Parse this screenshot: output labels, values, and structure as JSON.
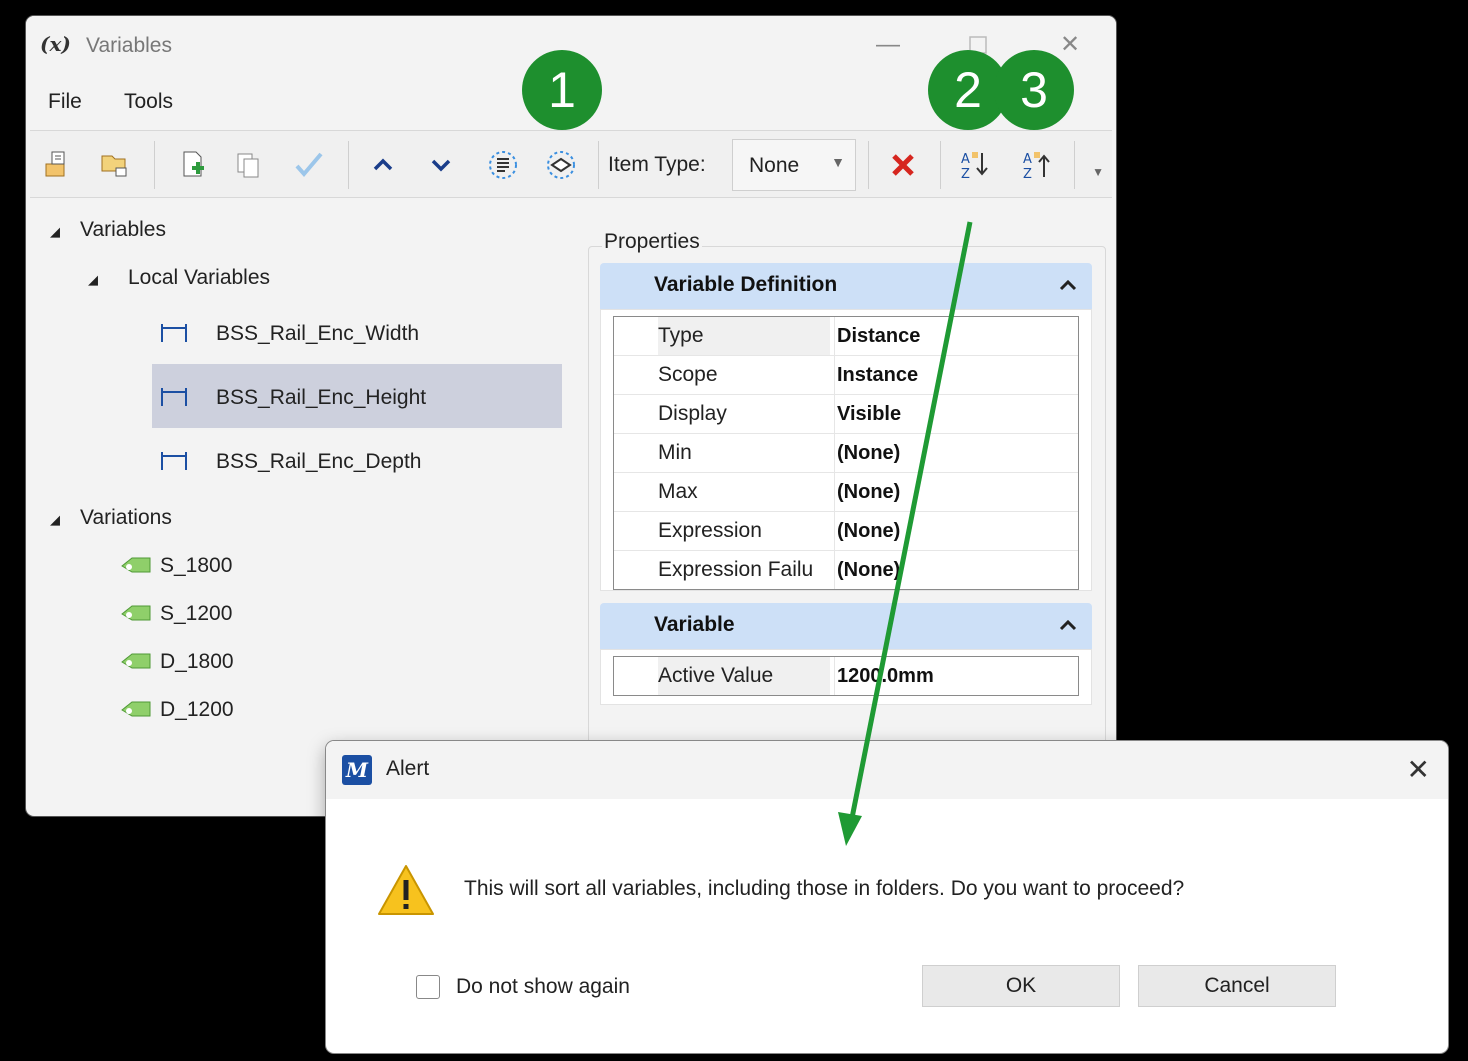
{
  "window": {
    "app_icon": "(x)",
    "title": "Variables",
    "minimize": "—",
    "close": "✕"
  },
  "menu": [
    "File",
    "Tools"
  ],
  "toolbar": {
    "item_type_label": "Item Type:",
    "item_type_value": "None",
    "icons": [
      "new-folder-icon",
      "new-variable-icon",
      "add-icon",
      "copy-icon",
      "check-icon",
      "move-up-icon",
      "move-down-icon",
      "list-icon",
      "shape-icon",
      "delete-icon",
      "sort-ascending-icon",
      "sort-descending-icon"
    ]
  },
  "tree": {
    "root": "Variables",
    "local": "Local Variables",
    "variables": [
      "BSS_Rail_Enc_Width",
      "BSS_Rail_Enc_Height",
      "BSS_Rail_Enc_Depth"
    ],
    "variations_root": "Variations",
    "variations": [
      "S_1800",
      "S_1200",
      "D_1800",
      "D_1200"
    ]
  },
  "properties": {
    "label": "Properties",
    "definition_title": "Variable Definition",
    "definition_rows": [
      {
        "key": "Type",
        "value": "Distance"
      },
      {
        "key": "Scope",
        "value": "Instance"
      },
      {
        "key": "Display",
        "value": "Visible"
      },
      {
        "key": "Min",
        "value": "(None)"
      },
      {
        "key": "Max",
        "value": "(None)"
      },
      {
        "key": "Expression",
        "value": "(None)"
      },
      {
        "key": "Expression Failu",
        "value": "(None)"
      }
    ],
    "variable_title": "Variable",
    "variable_rows": [
      {
        "key": "Active Value",
        "value": "1200.0mm"
      }
    ]
  },
  "badges": [
    "1",
    "2",
    "3"
  ],
  "alert": {
    "logo": "M",
    "title": "Alert",
    "close": "✕",
    "message": "This will sort all variables, including those in folders. Do you want to proceed?",
    "checkbox_label": "Do not show again",
    "ok": "OK",
    "cancel": "Cancel"
  },
  "colors": {
    "badge": "#1e8f2e",
    "section_header": "#cde0f7",
    "selection": "#cdd0dd",
    "arrow": "#1f9a34"
  }
}
